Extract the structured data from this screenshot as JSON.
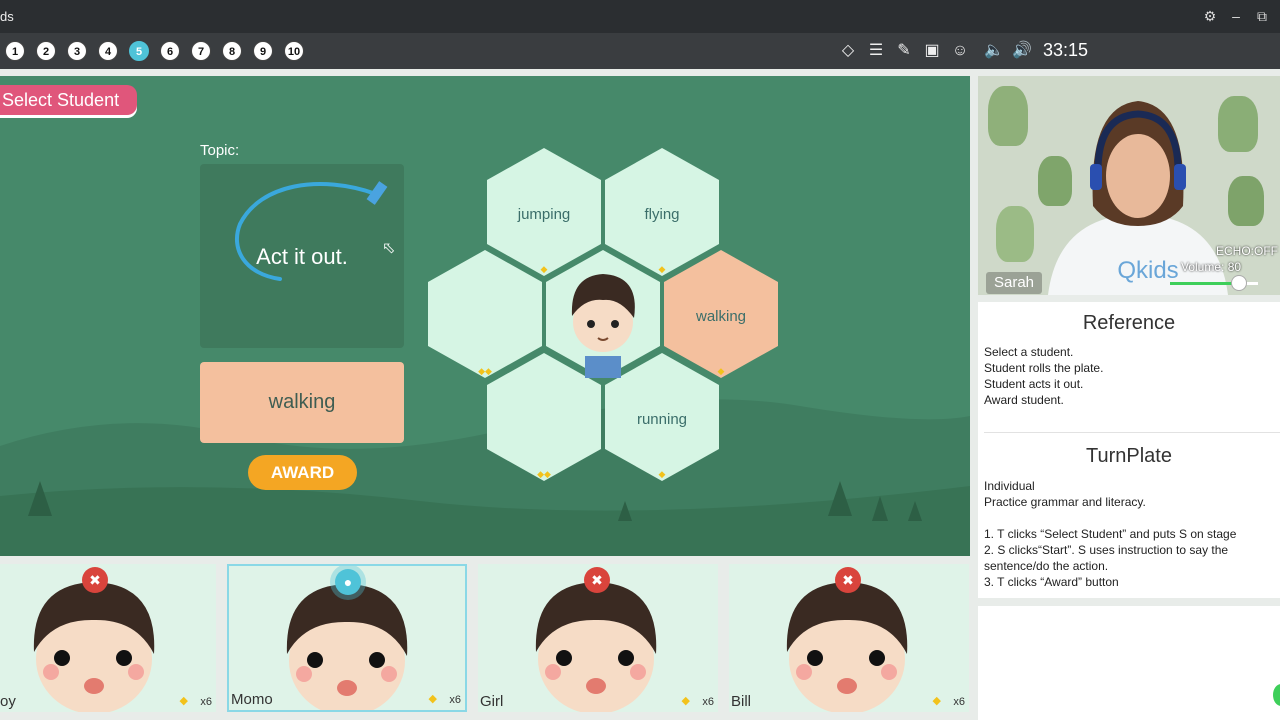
{
  "app": {
    "title": "ds"
  },
  "toolbar": {
    "steps": [
      "1",
      "2",
      "3",
      "4",
      "5",
      "6",
      "7",
      "8",
      "9",
      "10"
    ],
    "active_step": "5",
    "timer": "33:15"
  },
  "stage": {
    "select_label": "Select Student",
    "topic_label": "Topic:",
    "topic_text": "Act it out.",
    "selected_word": "walking",
    "award_label": "AWARD",
    "hex_words": [
      "jumping",
      "flying",
      "walking",
      "running"
    ]
  },
  "video": {
    "echo": "ECHO:OFF",
    "volume_label": "Volume: 80",
    "volume_level": 0.8,
    "name": "Sarah",
    "shirt_text": "Qkids"
  },
  "reference": {
    "title": "Reference",
    "lines": [
      "Select a student.",
      "Student rolls the plate.",
      "Student acts it out.",
      "Award student."
    ]
  },
  "turnplate": {
    "title": "TurnPlate",
    "line1": "Individual",
    "line2": "Practice grammar and literacy.",
    "step1": "1. T clicks “Select Student” and puts S on stage",
    "step2": "2. S clicks“Start”. S uses instruction to say the sentence/do the action.",
    "step3": "3. T clicks “Award” button"
  },
  "students": [
    {
      "name": "oy",
      "count": "x6",
      "mic": "muted"
    },
    {
      "name": "Momo",
      "count": "x6",
      "mic": "on"
    },
    {
      "name": "Girl",
      "count": "x6",
      "mic": "muted"
    },
    {
      "name": "Bill",
      "count": "x6",
      "mic": "muted"
    }
  ],
  "colors": {
    "stage": "#46896a",
    "select_button": "#e0567b",
    "award_button": "#f4a623",
    "hex": "#d6f5e4",
    "hex_selected": "#f4c09e",
    "active_step": "#4fc3d8"
  }
}
